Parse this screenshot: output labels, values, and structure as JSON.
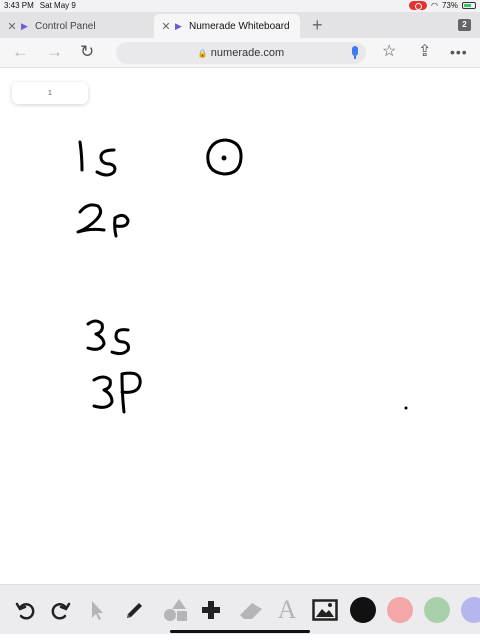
{
  "status_bar": {
    "time": "3:43 PM",
    "date": "Sat May 9",
    "battery": "73%",
    "battery_level": 0.73
  },
  "tabs": [
    {
      "label": "Control Panel",
      "active": false
    },
    {
      "label": "Numerade Whiteboard",
      "active": true
    }
  ],
  "tab_count": "2",
  "toolbar": {
    "url": "numerade.com"
  },
  "page_indicator": "1",
  "whiteboard": {
    "ink_color": "#000000",
    "handwriting": [
      "1s",
      "2p",
      "3s",
      "3P"
    ]
  },
  "bottom_tools": {
    "icons": [
      "undo-icon",
      "redo-icon",
      "pointer-icon",
      "pen-icon",
      "shapes-icon",
      "add-icon",
      "eraser-icon",
      "text-icon",
      "image-icon"
    ],
    "colors": [
      "#111111",
      "#f4a7a7",
      "#a9d1a9",
      "#b3b7ee"
    ]
  },
  "colors": {
    "accent": "#6f5bd6",
    "mic": "#3f7af0",
    "record": "#e5322d"
  }
}
